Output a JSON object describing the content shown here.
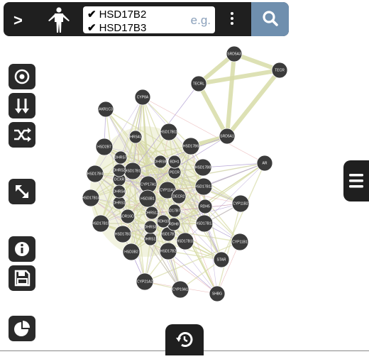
{
  "toolbar": {
    "expand_label": ">",
    "genes": [
      "HSD17B2",
      "HSD17B3"
    ],
    "placeholder": "e.g."
  },
  "tools": [
    {
      "name": "target-icon"
    },
    {
      "name": "sort-arrows-icon"
    },
    {
      "name": "shuffle-icon"
    },
    {
      "name": "resize-icon"
    },
    {
      "name": "info-icon"
    },
    {
      "name": "save-icon"
    },
    {
      "name": "pie-chart-icon"
    }
  ],
  "network": {
    "nodes": [
      {
        "label": "SRD5A3"
      },
      {
        "label": "TECR"
      },
      {
        "label": "TECRL"
      },
      {
        "label": "SRD5A1"
      },
      {
        "label": "CYP8A"
      },
      {
        "label": "AKR1C3"
      },
      {
        "label": "HSD17B11"
      },
      {
        "label": "HSD17B6"
      },
      {
        "label": "DHRS4L2"
      },
      {
        "label": "HSD2B7"
      },
      {
        "label": "HSD17B4"
      },
      {
        "label": "DHRS7"
      },
      {
        "label": "HSD17B1"
      },
      {
        "label": "HSD17B8"
      },
      {
        "label": "AR"
      },
      {
        "label": "HSD17B12"
      },
      {
        "label": "HSD17B14"
      },
      {
        "label": "CYP17A1"
      },
      {
        "label": "CYP11A1"
      },
      {
        "label": "DECR2"
      },
      {
        "label": "PECR"
      },
      {
        "label": "RDH5"
      },
      {
        "label": "DCXR"
      },
      {
        "label": "HSD3B1"
      },
      {
        "label": "HSD17B13"
      },
      {
        "label": "CYP11B2"
      },
      {
        "label": "HSD17B15"
      },
      {
        "label": "SDR16C5"
      },
      {
        "label": "HSD17B3"
      },
      {
        "label": "HSD17B2"
      },
      {
        "label": "HSD17B10"
      },
      {
        "label": "CYP11B1"
      },
      {
        "label": "HSD3B2"
      },
      {
        "label": "HSD17B7"
      },
      {
        "label": "STAR"
      },
      {
        "label": "CYP21A2"
      },
      {
        "label": "CYP19A1"
      },
      {
        "label": "SHBG"
      },
      {
        "label": "RDH8"
      },
      {
        "label": "DHRS11"
      },
      {
        "label": "DHRS1"
      },
      {
        "label": "DHRS4"
      },
      {
        "label": "DHRS2"
      },
      {
        "label": "DHRS9"
      },
      {
        "label": "HSD11B1"
      },
      {
        "label": "BDH1"
      },
      {
        "label": "RDH10"
      },
      {
        "label": "DHRS3"
      },
      {
        "label": "HSD17B7P2"
      },
      {
        "label": "DHRS12"
      }
    ]
  },
  "colors": {
    "bar": "#1f1f1f",
    "search": "#6f8fae",
    "node": "#3b3b3b",
    "edge_main": "#d8dca8",
    "edge_purple": "#b7a6d6",
    "edge_red": "#e3a0a0"
  }
}
